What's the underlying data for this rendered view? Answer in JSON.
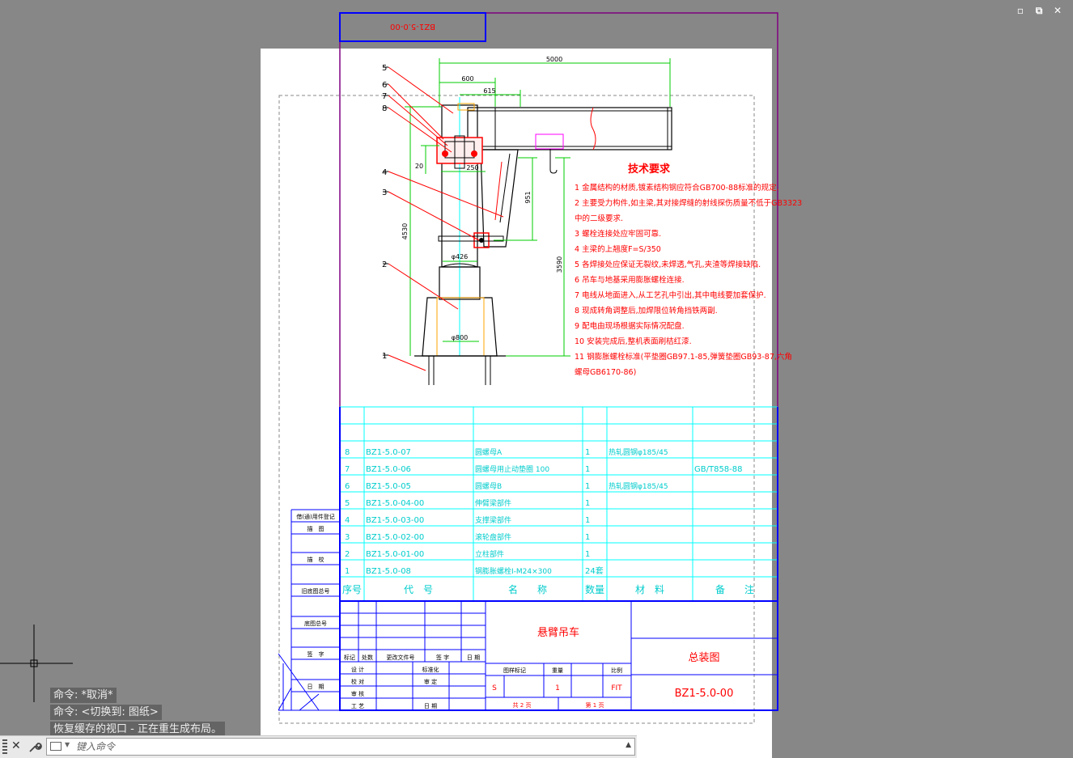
{
  "window_controls": {
    "minimize": "▫",
    "restore": "⧉",
    "close": "✕"
  },
  "colors": {
    "workspace_bg": "#878787",
    "paper": "#ffffff",
    "title_text": "#ff0000",
    "table_lines": "#00ffff",
    "frame_lines": "#0000ff",
    "viewport_border": "#800080",
    "dims": "#00cc00"
  },
  "drawing": {
    "top_tag": "BZ1-5.0-00",
    "dims": {
      "d5000": "5000",
      "d600": "600",
      "d615": "615",
      "d20": "20",
      "d250": "250",
      "d951": "951",
      "d4530": "4530",
      "d3590": "3590",
      "d426": "φ426",
      "d800": "φ800"
    },
    "callouts": [
      "5",
      "6",
      "7",
      "8",
      "4",
      "3",
      "2",
      "1"
    ],
    "requirements": {
      "title": "技术要求",
      "lines": [
        "1  金属结构的材质,镀素结构钢应符合GB700-88标准的规定.",
        "2  主要受力构件,如主梁,其对接焊缝的射线探伤质量不低于GB3323",
        "中的二级要求.",
        "3  螺栓连接处应牢固可靠.",
        "4  主梁的上翘度F=S/350",
        "5  各焊接处应保证无裂纹,未焊透,气孔,夹渣等焊接缺陷.",
        "6  吊车与地基采用膨胀螺栓连接.",
        "7  电线从地面进入,从工艺孔中引出,其中电线要加套保护.",
        "8  现成转角调整后,加焊限位转角挡铁两副.",
        "9  配电由现场根据实际情况配盘.",
        "10  安装完成后,整机表面刷桔红漆.",
        "11  钢膨胀螺栓标准(平垫圈GB97.1-85,弹簧垫圈GB93-87,六角",
        "螺母GB6170-86)"
      ]
    },
    "bom_rows": [
      {
        "no": "8",
        "code": "BZ1-5.0-07",
        "name": "圆螺母A",
        "qty": "1",
        "material": "热轧圆钢φ185/45",
        "remark": ""
      },
      {
        "no": "7",
        "code": "BZ1-5.0-06",
        "name": "圆螺母用止动垫圈 100",
        "qty": "1",
        "material": "",
        "remark": "GB/T858-88"
      },
      {
        "no": "6",
        "code": "BZ1-5.0-05",
        "name": "圆螺母B",
        "qty": "1",
        "material": "热轧圆钢φ185/45",
        "remark": ""
      },
      {
        "no": "5",
        "code": "BZ1-5.0-04-00",
        "name": "伸臂梁部件",
        "qty": "1",
        "material": "",
        "remark": ""
      },
      {
        "no": "4",
        "code": "BZ1-5.0-03-00",
        "name": "支撑梁部件",
        "qty": "1",
        "material": "",
        "remark": ""
      },
      {
        "no": "3",
        "code": "BZ1-5.0-02-00",
        "name": "滚轮盘部件",
        "qty": "1",
        "material": "",
        "remark": ""
      },
      {
        "no": "2",
        "code": "BZ1-5.0-01-00",
        "name": "立柱部件",
        "qty": "1",
        "material": "",
        "remark": ""
      },
      {
        "no": "1",
        "code": "BZ1-5.0-08",
        "name": "钢膨胀螺栓I-M24×300",
        "qty": "24套",
        "material": "",
        "remark": ""
      }
    ],
    "bom_header": {
      "no": "序号",
      "code": "代　号",
      "name": "名　　称",
      "qty": "数量",
      "material": "材　料",
      "remark": "备　　注"
    },
    "side_labels": [
      "借(通)用件登记",
      "描　图",
      "描　校",
      "旧底图总号",
      "底图总号",
      "签　字",
      "日　期"
    ],
    "title_block": {
      "product": "悬臂吊车",
      "drawing_title": "总装图",
      "drawing_no": "BZ1-5.0-00",
      "rev_headers": [
        "标记",
        "处数",
        "更改文件号",
        "签 字",
        "日 期"
      ],
      "signers": [
        "设 计",
        "校 对",
        "审 核",
        "工 艺"
      ],
      "sign_mid": [
        "标准化",
        "审 定",
        "日 期"
      ],
      "meta_headers": [
        "图样标记",
        "重量",
        "比例"
      ],
      "mark": "S",
      "weight": "1",
      "scale": "FIT",
      "total_sheets": "共  2  页",
      "sheet": "第  1  页"
    }
  },
  "command_line": {
    "history": [
      "命令: *取消*",
      "命令:  <切换到: 图纸>",
      "恢复缓存的视口 - 正在重生成布局。"
    ],
    "placeholder": "键入命令",
    "value": ""
  }
}
